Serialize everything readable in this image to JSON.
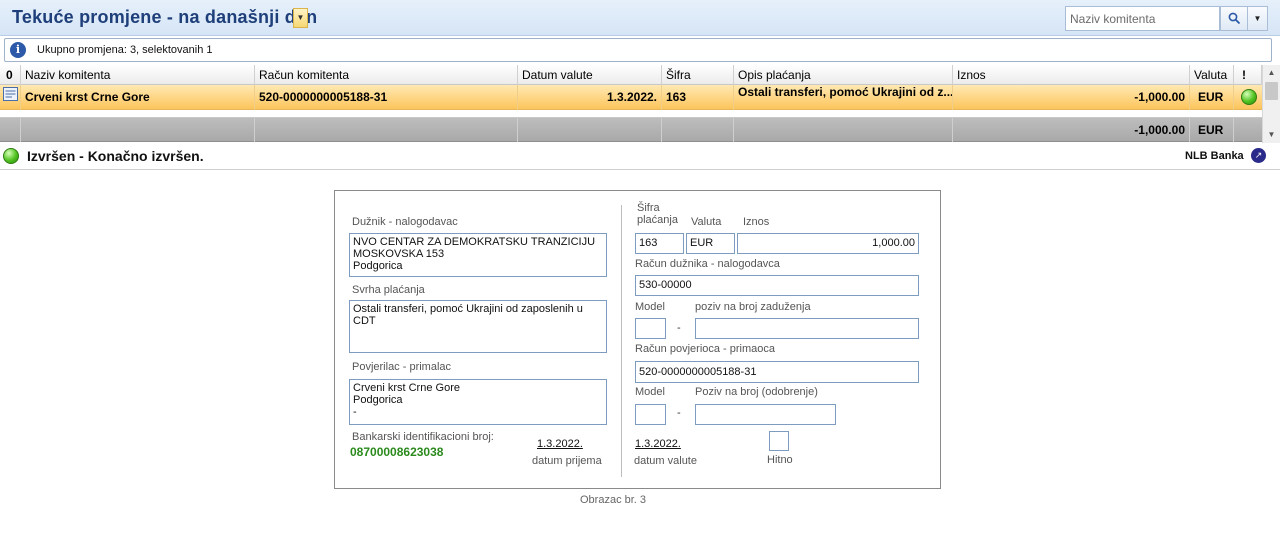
{
  "header": {
    "title": "Tekuće promjene - na današnji dan",
    "search_placeholder": "Naziv komitenta"
  },
  "infobar": {
    "text": "Ukupno promjena: 3, selektovanih 1"
  },
  "grid": {
    "columns": {
      "attach": "0",
      "naziv": "Naziv komitenta",
      "racun": "Račun komitenta",
      "datum": "Datum valute",
      "sifra": "Šifra",
      "opis": "Opis plaćanja",
      "iznos": "Iznos",
      "valuta": "Valuta",
      "flag": "!"
    },
    "row": {
      "naziv": "Crveni krst Crne Gore",
      "racun": "520-0000000005188-31",
      "datum": "1.3.2022.",
      "sifra": "163",
      "opis": "Ostali transferi, pomoć Ukrajini od z...",
      "iznos": "-1,000.00",
      "valuta": "EUR",
      "status_color": "#4fc21f"
    },
    "total": {
      "iznos": "-1,000.00",
      "valuta": "EUR"
    }
  },
  "status": {
    "text": "Izvršen - Konačno izvršen.",
    "bank": "NLB Banka"
  },
  "form": {
    "duznik_label": "Dužnik - nalogodavac",
    "duznik_value": "NVO CENTAR ZA DEMOKRATSKU TRANZICIJU\nMOSKOVSKA 153\nPodgorica",
    "svrha_label": "Svrha plaćanja",
    "svrha_value": "Ostali transferi, pomoć Ukrajini od zaposlenih u CDT",
    "povjerilac_label": "Povjerilac - primalac",
    "povjerilac_value": "Crveni krst Crne Gore\nPodgorica\n-",
    "bic_label": "Bankarski identifikacioni broj:",
    "bic_value": "08700008623038",
    "sifra_label": "Šifra\nplaćanja",
    "sifra_value": "163",
    "valuta_label": "Valuta",
    "valuta_value": "EUR",
    "iznos_label": "Iznos",
    "iznos_value": "1,000.00",
    "racun_duznika_label": "Račun dužnika - nalogodavca",
    "racun_duznika_value": "530-00000",
    "model1_label": "Model",
    "poziv1_label": "poziv na broj zaduženja",
    "racun_povjerioca_label": "Račun povjerioca - primaoca",
    "racun_povjerioca_value": "520-0000000005188-31",
    "model2_label": "Model",
    "poziv2_label": "Poziv na broj (odobrenje)",
    "dash": "-",
    "datum_prijema": "1.3.2022.",
    "datum_prijema_label": "datum prijema",
    "datum_valute": "1.3.2022.",
    "datum_valute_label": "datum valute",
    "hitno_label": "Hitno",
    "caption": "Obrazac br. 3"
  }
}
